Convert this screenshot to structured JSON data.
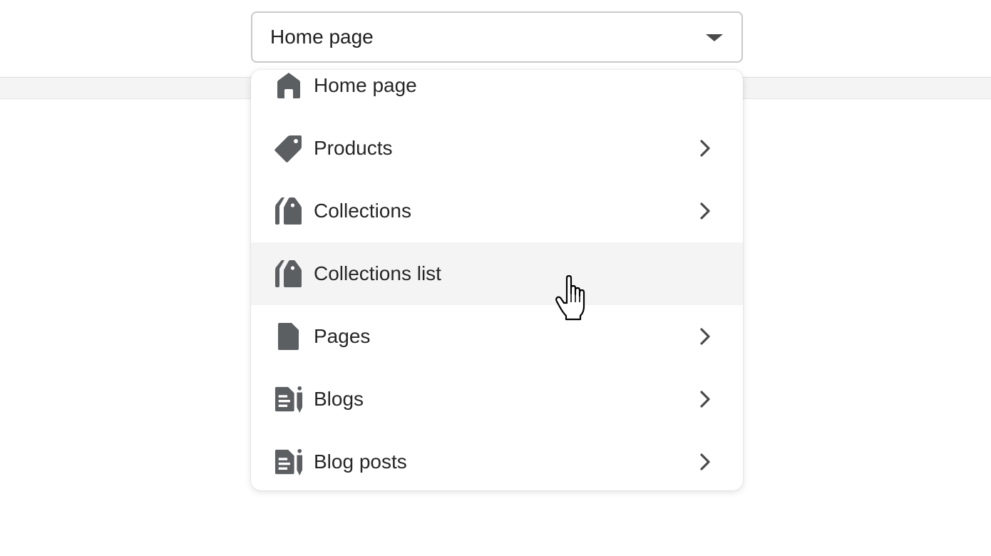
{
  "select": {
    "value": "Home page",
    "caret_icon": "caret-down-icon"
  },
  "menu": {
    "items": [
      {
        "label": "Home page",
        "icon": "home-icon",
        "has_submenu": false
      },
      {
        "label": "Products",
        "icon": "tag-icon",
        "has_submenu": true
      },
      {
        "label": "Collections",
        "icon": "collection-tags-icon",
        "has_submenu": true
      },
      {
        "label": "Collections list",
        "icon": "collection-tags-icon",
        "has_submenu": false,
        "hovered": true
      },
      {
        "label": "Pages",
        "icon": "page-icon",
        "has_submenu": true
      },
      {
        "label": "Blogs",
        "icon": "blog-icon",
        "has_submenu": true
      },
      {
        "label": "Blog posts",
        "icon": "blog-icon",
        "has_submenu": true
      }
    ]
  },
  "colors": {
    "icon": "#5c5f62",
    "hover_background": "#f4f4f4",
    "text": "#262626"
  }
}
